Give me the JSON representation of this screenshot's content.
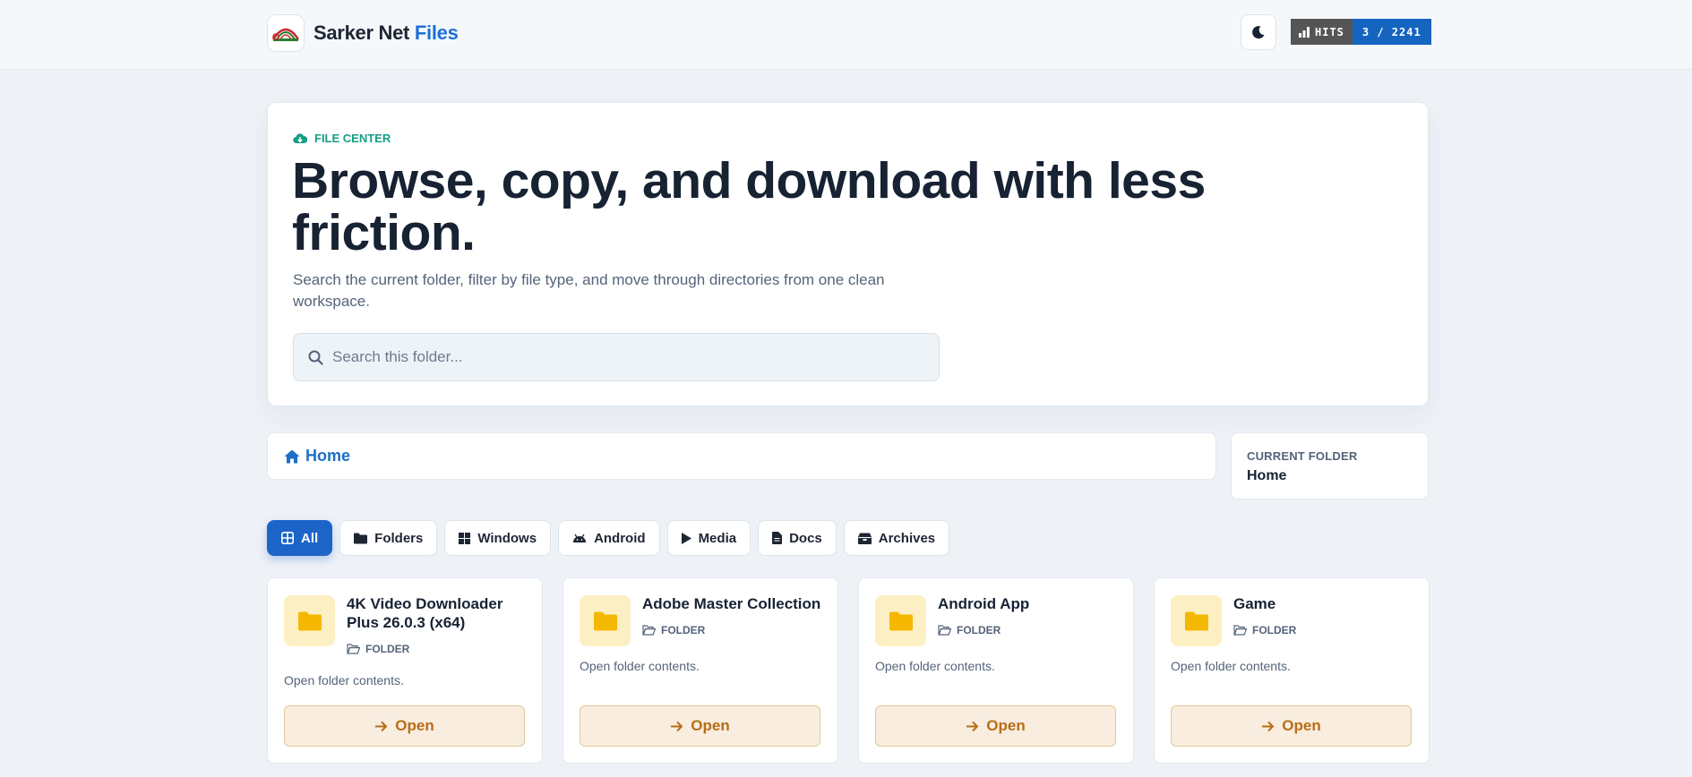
{
  "brand": {
    "name_main": "Sarker Net",
    "name_accent": "Files"
  },
  "hits": {
    "label": "HITS",
    "value": "3 / 2241"
  },
  "hero": {
    "eyebrow": "FILE CENTER",
    "title": "Browse, copy, and download with less friction.",
    "subtitle": "Search the current folder, filter by file type, and move through directories from one clean workspace.",
    "search_placeholder": "Search this folder..."
  },
  "breadcrumb": {
    "home": "Home"
  },
  "current_folder": {
    "label": "CURRENT FOLDER",
    "value": "Home"
  },
  "filters": [
    {
      "label": "All",
      "icon": "grid-icon"
    },
    {
      "label": "Folders",
      "icon": "folder-icon"
    },
    {
      "label": "Windows",
      "icon": "windows-icon"
    },
    {
      "label": "Android",
      "icon": "android-icon"
    },
    {
      "label": "Media",
      "icon": "play-icon"
    },
    {
      "label": "Docs",
      "icon": "document-icon"
    },
    {
      "label": "Archives",
      "icon": "archive-icon"
    }
  ],
  "cards": [
    {
      "title": "4K Video Downloader Plus 26.0.3 (x64)",
      "tag": "FOLDER",
      "desc": "Open folder contents.",
      "button": "Open"
    },
    {
      "title": "Adobe Master Collection",
      "tag": "FOLDER",
      "desc": "Open folder contents.",
      "button": "Open"
    },
    {
      "title": "Android App",
      "tag": "FOLDER",
      "desc": "Open folder contents.",
      "button": "Open"
    },
    {
      "title": "Game",
      "tag": "FOLDER",
      "desc": "Open folder contents.",
      "button": "Open"
    }
  ],
  "colors": {
    "accent": "#1d64c8",
    "teal": "#139e86",
    "folder": "#f5b800",
    "open_text": "#b86d17"
  }
}
